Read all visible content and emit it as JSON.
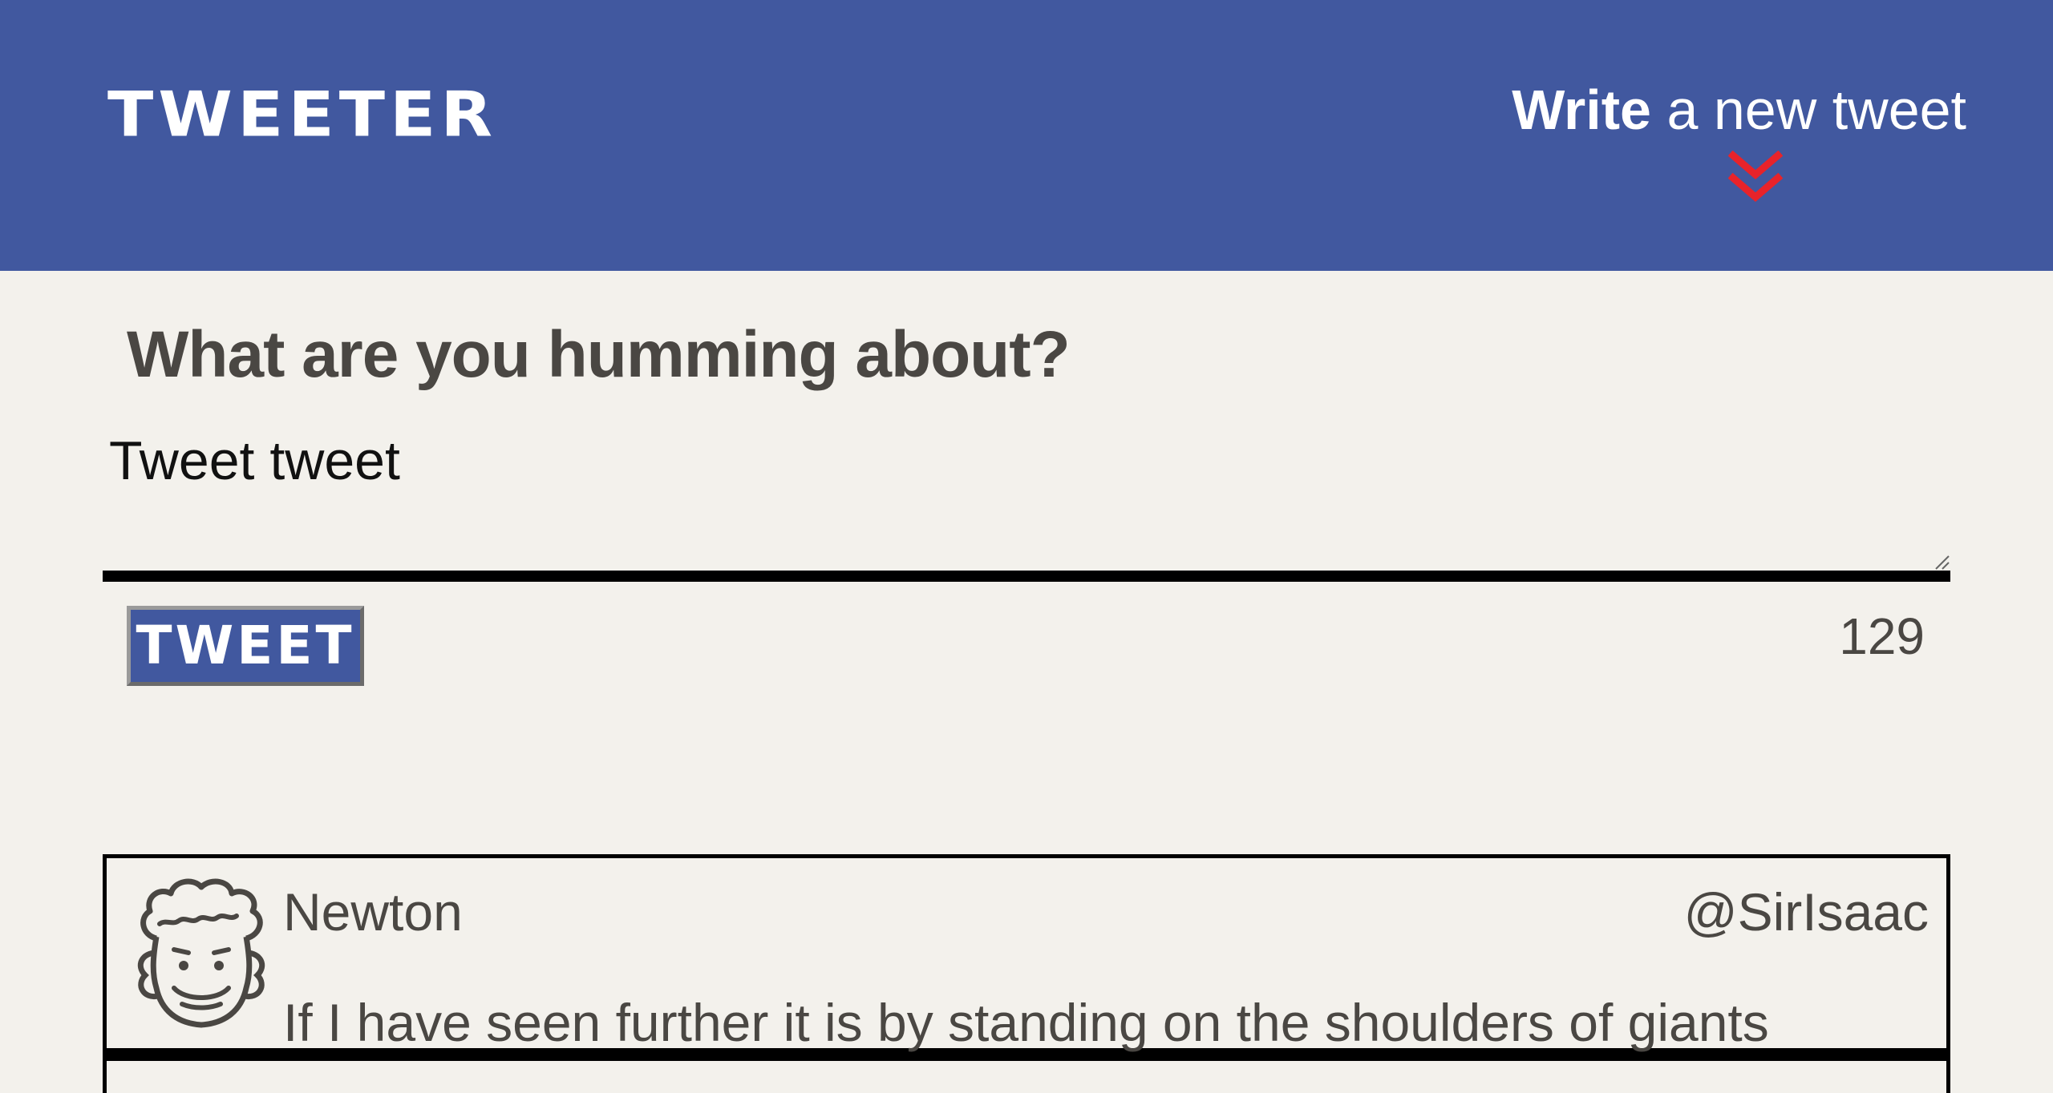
{
  "navbar": {
    "brand": "TWEETER",
    "compose_strong": "Write",
    "compose_rest": " a new tweet",
    "chevron_color": "#e8232a",
    "background_color": "#41589f"
  },
  "composer": {
    "title": "What are you humming about?",
    "textarea_value": "Tweet tweet",
    "button_label": "TWEET",
    "char_counter": "129"
  },
  "tweets": [
    {
      "name": "Newton",
      "handle": "@SirIsaac",
      "text": "If I have seen further it is by standing on the shoulders of giants",
      "avatar_icon": "curly-haired-face-avatar"
    }
  ]
}
